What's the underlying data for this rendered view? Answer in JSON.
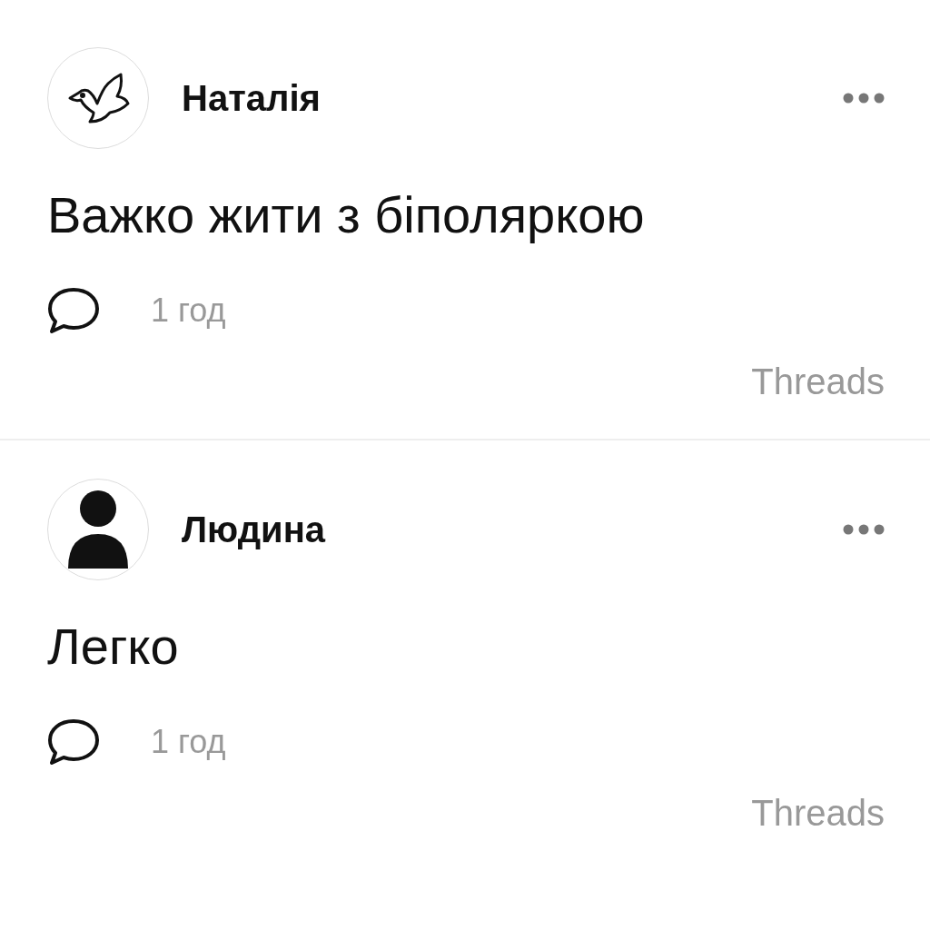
{
  "posts": [
    {
      "author": "Наталія",
      "avatar": {
        "kind": "bird"
      },
      "text": "Важко жити з біполяркою",
      "time": "1 год",
      "source": "Threads"
    },
    {
      "author": "Людина",
      "avatar": {
        "kind": "person"
      },
      "text": "Легко",
      "time": "1 год",
      "source": "Threads"
    }
  ]
}
